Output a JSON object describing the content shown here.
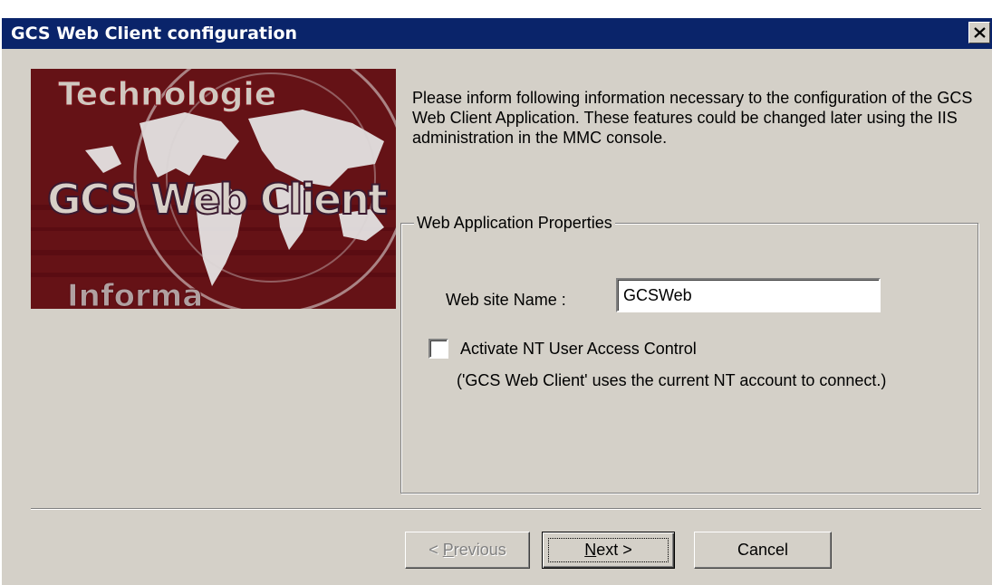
{
  "window": {
    "title": "GCS Web Client configuration",
    "close_icon": "close-icon"
  },
  "logo": {
    "top_word": "Technologie",
    "middle_word": "GCS Web Client",
    "bottom_word": "Informa",
    "colors": {
      "maroon": "#7a1018",
      "dark": "#2a1a10",
      "map": "#e8e8e8"
    }
  },
  "intro_text": "Please inform following information necessary to the configuration of the GCS Web Client Application. These features could be changed later using the IIS administration in the MMC console.",
  "properties": {
    "group_title": "Web Application Properties",
    "site_name_label": "Web site Name :",
    "site_name_value": "GCSWeb",
    "nt_checkbox_label": "Activate NT User Access Control",
    "nt_checkbox_checked": false,
    "nt_note": "('GCS Web Client' uses the current NT account to connect.)"
  },
  "buttons": {
    "previous": {
      "prefix": "< ",
      "accel": "P",
      "rest": "revious",
      "enabled": false
    },
    "next": {
      "accel": "N",
      "rest": "ext >"
    },
    "cancel": "Cancel"
  },
  "colors": {
    "titlebar": "#0a246a",
    "face": "#d4d0c8"
  }
}
